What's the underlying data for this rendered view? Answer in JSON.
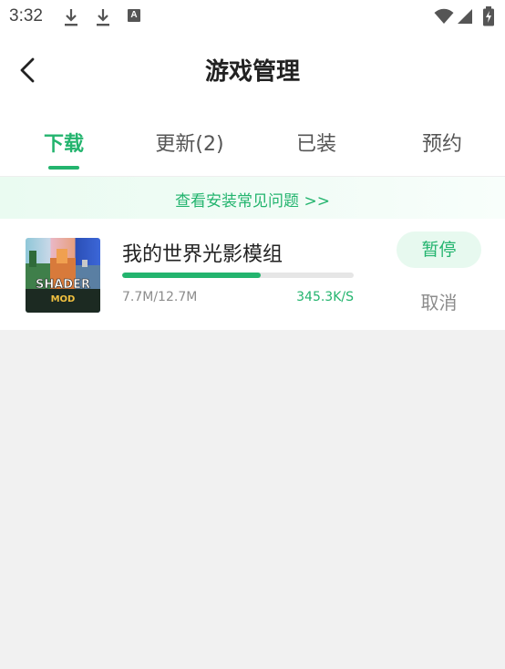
{
  "status_bar": {
    "time": "3:32",
    "notification_icons": [
      "download-icon",
      "download-icon",
      "a-icon"
    ],
    "system_icons": [
      "wifi-icon",
      "signal-icon",
      "battery-charging-icon"
    ]
  },
  "header": {
    "title": "游戏管理",
    "back_icon": "chevron-left-icon"
  },
  "tabs": [
    {
      "label": "下载",
      "active": true
    },
    {
      "label": "更新(2)",
      "active": false
    },
    {
      "label": "已装",
      "active": false
    },
    {
      "label": "预约",
      "active": false
    }
  ],
  "faq_banner": {
    "text": "查看安装常见问题 >>"
  },
  "downloads": [
    {
      "name": "我的世界光影模组",
      "progress_fraction": 0.6,
      "size_text": "7.7M/12.7M",
      "speed_text": "345.3K/S",
      "pause_label": "暂停",
      "cancel_label": "取消",
      "icon_text": [
        "SHADER",
        "MOD"
      ]
    }
  ],
  "colors": {
    "accent": "#23b46e",
    "accent_light": "#e7f9ef",
    "background": "#f1f1f1"
  }
}
